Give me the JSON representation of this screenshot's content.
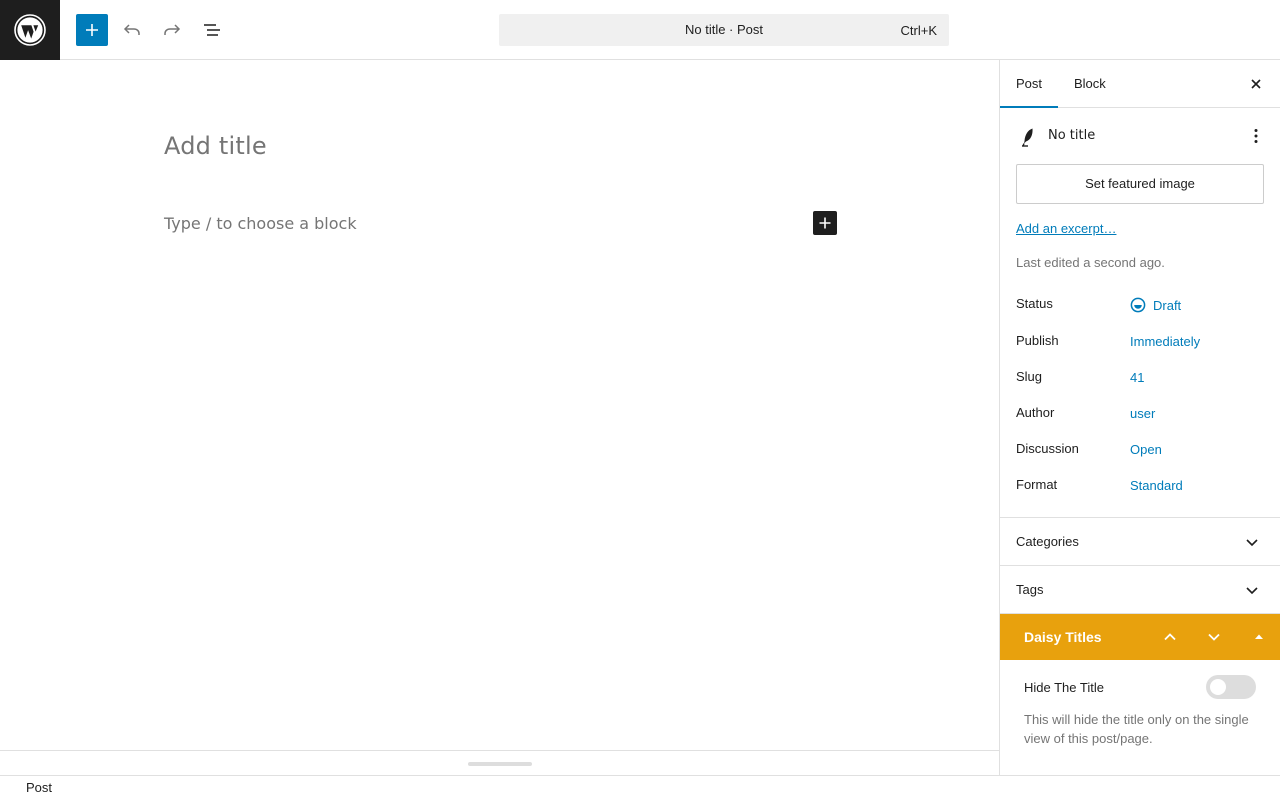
{
  "header": {
    "command_bar": {
      "title": "No title · Post",
      "shortcut": "Ctrl+K"
    }
  },
  "editor": {
    "title_placeholder": "Add title",
    "block_placeholder": "Type / to choose a block"
  },
  "sidebar": {
    "tabs": [
      {
        "label": "Post"
      },
      {
        "label": "Block"
      }
    ],
    "post": {
      "title": "No title",
      "featured_image_label": "Set featured image",
      "excerpt_link": "Add an excerpt…",
      "last_edited": "Last edited a second ago.",
      "rows": [
        {
          "label": "Status",
          "value": "Draft"
        },
        {
          "label": "Publish",
          "value": "Immediately"
        },
        {
          "label": "Slug",
          "value": "41"
        },
        {
          "label": "Author",
          "value": "user"
        },
        {
          "label": "Discussion",
          "value": "Open"
        },
        {
          "label": "Format",
          "value": "Standard"
        }
      ]
    },
    "panels": [
      {
        "label": "Categories"
      },
      {
        "label": "Tags"
      }
    ],
    "daisy": {
      "title": "Daisy Titles",
      "hide_label": "Hide The Title",
      "hide_checked": false,
      "help": "This will hide the title only on the single view of this post/page.",
      "color": "#e8a10d"
    }
  },
  "footer": {
    "breadcrumb": "Post"
  },
  "colors": {
    "accent": "#007cba",
    "dark": "#1e1e1e"
  }
}
